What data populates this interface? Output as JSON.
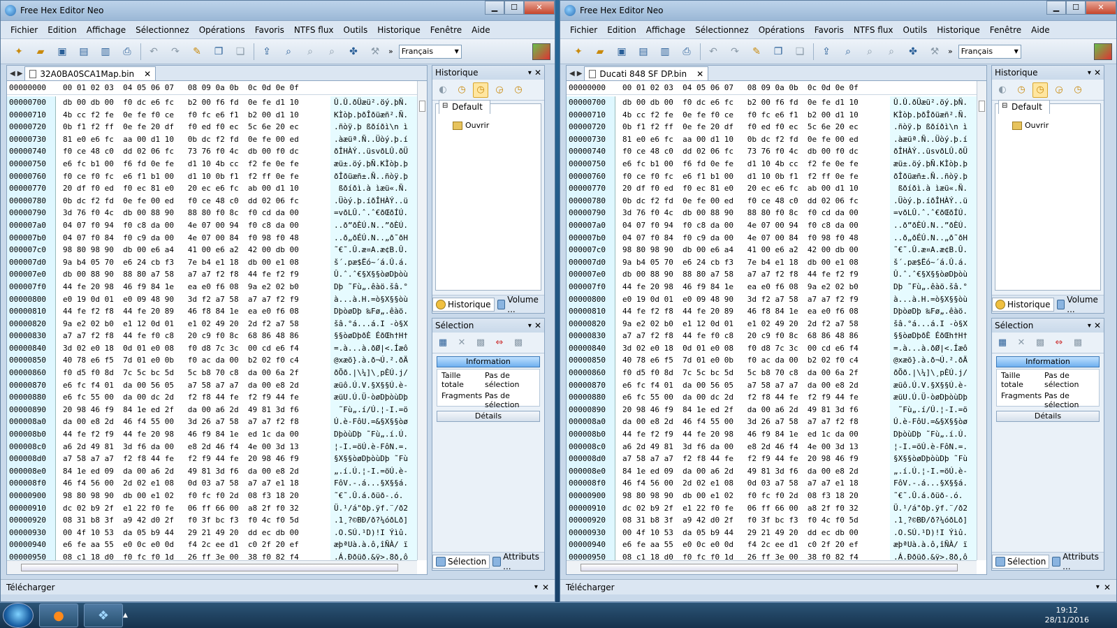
{
  "windows": [
    {
      "title": "Free Hex Editor Neo",
      "tab_file": "32A0BA0SCA1Map.bin"
    },
    {
      "title": "Free Hex Editor Neo",
      "tab_file": "Ducati 848 SF DP.bin"
    }
  ],
  "title_buttons": {
    "minimize": "▁",
    "maximize": "☐",
    "close": "✕"
  },
  "menu": [
    "Fichier",
    "Edition",
    "Affichage",
    "Sélectionnez",
    "Opérations",
    "Favoris",
    "NTFS flux",
    "Outils",
    "Historique",
    "Fenêtre",
    "Aide"
  ],
  "toolbar": {
    "language": "Français",
    "more": "»"
  },
  "hex": {
    "header_offset": "00000000",
    "header_cols": "00 01 02 03  04 05 06 07   08 09 0a 0b  0c 0d 0e 0f",
    "rows": [
      {
        "o": "00000700",
        "h": "db 00 db 00  f0 dc e6 fc   b2 00 f6 fd  0e fe d1 10",
        "a": "Û.Û.ðÜæü².öý.þÑ."
      },
      {
        "o": "00000710",
        "h": "4b cc f2 fe  0e fe f0 ce   f0 fc e6 f1  b2 00 d1 10",
        "a": "KÌòþ.þðÎðüæñ².Ñ."
      },
      {
        "o": "00000720",
        "h": "0b f1 f2 ff  0e fe 20 df   f0 ed f0 ec  5c 6e 20 ec",
        "a": ".ñòÿ.þ ßðíðì\\n ì"
      },
      {
        "o": "00000730",
        "h": "81 e0 e6 fc  aa 00 d1 10   0b dc f2 fd  0e fe 00 ed",
        "a": ".àæüª.Ñ..Üòý.þ.í"
      },
      {
        "o": "00000740",
        "h": "f0 ce 48 c0  dd 02 06 fc   73 76 f0 4c  db 00 f0 dc",
        "a": "ðÎHÀÝ..üsvðLÛ.ðÜ"
      },
      {
        "o": "00000750",
        "h": "e6 fc b1 00  f6 fd 0e fe   d1 10 4b cc  f2 fe 0e fe",
        "a": "æü±.öý.þÑ.KÌòþ.þ"
      },
      {
        "o": "00000760",
        "h": "f0 ce f0 fc  e6 f1 b1 00   d1 10 0b f1  f2 ff 0e fe",
        "a": "ðÎðüæñ±.Ñ..ñòÿ.þ"
      },
      {
        "o": "00000770",
        "h": "20 df f0 ed  f0 ec 81 e0   20 ec e6 fc  ab 00 d1 10",
        "a": " ßðíðì.à ìæü«.Ñ."
      },
      {
        "o": "00000780",
        "h": "0b dc f2 fd  0e fe 00 ed   f0 ce 48 c0  dd 02 06 fc",
        "a": ".Üòý.þ.íðÎHÀÝ..ü"
      },
      {
        "o": "00000790",
        "h": "3d 76 f0 4c  db 00 88 90   88 80 f0 8c  f0 cd da 00",
        "a": "=vðLÛ.ˆ.ˆ€ðŒðÍÚ."
      },
      {
        "o": "000007a0",
        "h": "04 07 f0 94  f0 c8 da 00   4e 07 00 94  f0 c8 da 00",
        "a": "..ð”ðÈÚ.N..”ðÈÚ."
      },
      {
        "o": "000007b0",
        "h": "04 07 f0 84  f0 c9 da 00   4e 07 00 84  f0 98 f0 48",
        "a": "..ð„ðÉÚ.N..„ð˜ðH"
      },
      {
        "o": "000007c0",
        "h": "98 80 98 90  db 00 e6 a4   41 00 e6 a2  42 00 db 00",
        "a": "˜€˜.Û.æ¤A.æ¢B.Û."
      },
      {
        "o": "000007d0",
        "h": "9a b4 05 70  e6 24 cb f3   7e b4 e1 18  db 00 e1 08",
        "a": "š´.pæ$Ëó~´á.Û.á."
      },
      {
        "o": "000007e0",
        "h": "db 00 88 90  88 80 a7 58   a7 a7 f2 f8  44 fe f2 f9",
        "a": "Û.ˆ.ˆ€§X§§òøDþòù"
      },
      {
        "o": "000007f0",
        "h": "44 fe 20 98  46 f9 84 1e   ea e0 f6 08  9a e2 02 b0",
        "a": "Dþ ˜Fù„.êàö.šâ.°"
      },
      {
        "o": "00000800",
        "h": "e0 19 0d 01  e0 09 48 90   3d f2 a7 58  a7 a7 f2 f9",
        "a": "à...à.H.=ò§X§§òù"
      },
      {
        "o": "00000810",
        "h": "44 fe f2 f8  44 fe 20 89   46 f8 84 1e  ea e0 f6 08",
        "a": "DþòøDþ ‰Fø„.êàö."
      },
      {
        "o": "00000820",
        "h": "9a e2 02 b0  e1 12 0d 01   e1 02 49 20  2d f2 a7 58",
        "a": "šâ.°á...á.I -ò§X"
      },
      {
        "o": "00000830",
        "h": "a7 a7 f2 f8  44 fe f0 c8   20 c9 f0 8c  68 86 48 86",
        "a": "§§òøDþðÈ ÉðŒh†H†"
      },
      {
        "o": "00000840",
        "h": "3d 02 e0 18  0d 01 e0 08   f0 d8 7c 3c  00 cd e6 f4",
        "a": "=.à...à.ðØ|<.Íæô"
      },
      {
        "o": "00000850",
        "h": "40 78 e6 f5  7d 01 e0 0b   f0 ac da 00  b2 02 f0 c4",
        "a": "@xæõ}.à.ð¬Ú.².ðÄ"
      },
      {
        "o": "00000860",
        "h": "f0 d5 f0 8d  7c 5c bc 5d   5c b8 70 c8  da 00 6a 2f",
        "a": "ðÕð.|\\¼]\\¸pÈÚ.j/"
      },
      {
        "o": "00000870",
        "h": "e6 fc f4 01  da 00 56 05   a7 58 a7 a7  da 00 e8 2d",
        "a": "æüô.Ú.V.§X§§Ú.è-"
      },
      {
        "o": "00000880",
        "h": "e6 fc 55 00  da 00 dc 2d   f2 f8 44 fe  f2 f9 44 fe",
        "a": "æüU.Ú.Ü-òøDþòùDþ"
      },
      {
        "o": "00000890",
        "h": "20 98 46 f9  84 1e ed 2f   da 00 a6 2d  49 81 3d f6",
        "a": " ˜Fù„.í/Ú.¦-I.=ö"
      },
      {
        "o": "000008a0",
        "h": "da 00 e8 2d  46 f4 55 00   3d 26 a7 58  a7 a7 f2 f8",
        "a": "Ú.è-FôU.=&§X§§òø"
      },
      {
        "o": "000008b0",
        "h": "44 fe f2 f9  44 fe 20 98   46 f9 84 1e  ed 1c da 00",
        "a": "DþòùDþ ˜Fù„.í.Ú."
      },
      {
        "o": "000008c0",
        "h": "a6 2d 49 81  3d f6 da 00   e8 2d 46 f4  4e 00 3d 13",
        "a": "¦-I.=öÚ.è-FôN.=."
      },
      {
        "o": "000008d0",
        "h": "a7 58 a7 a7  f2 f8 44 fe   f2 f9 44 fe  20 98 46 f9",
        "a": "§X§§òøDþòùDþ ˜Fù"
      },
      {
        "o": "000008e0",
        "h": "84 1e ed 09  da 00 a6 2d   49 81 3d f6  da 00 e8 2d",
        "a": "„.í.Ú.¦-I.=öÚ.è-"
      },
      {
        "o": "000008f0",
        "h": "46 f4 56 00  2d 02 e1 08   0d 03 a7 58  a7 a7 e1 18",
        "a": "FôV.-.á...§X§§á."
      },
      {
        "o": "00000900",
        "h": "98 80 98 90  db 00 e1 02   f0 fc f0 2d  08 f3 18 20",
        "a": "˜€˜.Û.á.ðüð-.ó. "
      },
      {
        "o": "00000910",
        "h": "dc 02 b9 2f  e1 22 f0 fe   06 ff 66 00  a8 2f f0 32",
        "a": "Ü.¹/á\"ðþ.ÿf.¨/ð2"
      },
      {
        "o": "00000920",
        "h": "08 31 b8 3f  a9 42 d0 2f   f0 3f bc f3  f0 4c f0 5d",
        "a": ".1¸?©BÐ/ð?¼óðLð]"
      },
      {
        "o": "00000930",
        "h": "00 4f 10 53  da 05 b9 44   29 21 49 20  dd ec db 00",
        "a": ".O.SÚ.¹D)!I Ýìû."
      },
      {
        "o": "00000940",
        "h": "e6 fe aa 55  e0 0c e0 0d   f4 2c ee d1  c0 2f 20 ef",
        "a": "æþªUà.à.ô,îÑÀ/ ï"
      },
      {
        "o": "00000950",
        "h": "08 c1 18 d0  f0 fc f0 1d   26 ff 3e 00  38 f0 82 f4",
        "a": ".Á.Ððüð.&ÿ>.8ð‚ô"
      }
    ]
  },
  "panels": {
    "history_title": "Historique",
    "history_tab": "Default",
    "history_item": "Ouvrir",
    "history_tabs": [
      "Historique",
      "Volume ..."
    ],
    "selection_title": "Sélection",
    "info_label": "Information",
    "total_size_label": "Taille totale",
    "total_size_value": "Pas de sélection",
    "fragments_label": "Fragments",
    "fragments_value": "Pas de sélection",
    "details_label": "Détails",
    "selection_tabs": [
      "Sélection",
      "Attributs ..."
    ],
    "download_title": "Télécharger"
  },
  "taskbar": {
    "time": "19:12",
    "date": "28/11/2016",
    "tray_up": "▲"
  }
}
